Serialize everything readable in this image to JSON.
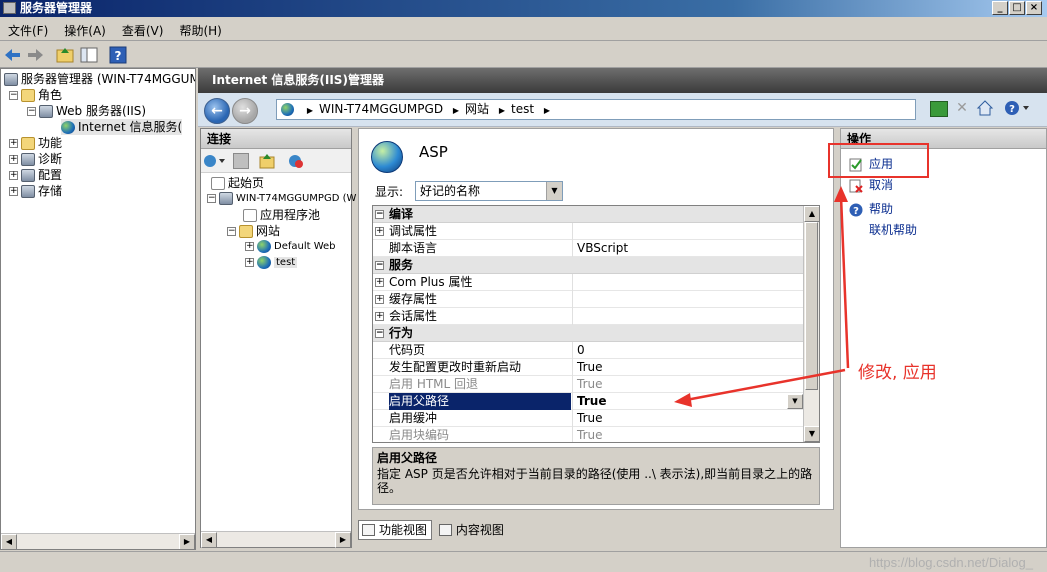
{
  "window": {
    "title": "服务器管理器"
  },
  "menu": [
    "文件(F)",
    "操作(A)",
    "查看(V)",
    "帮助(H)"
  ],
  "left_tree": {
    "root": "服务器管理器 (WIN-T74MGGUMPG",
    "roles": "角色",
    "web_server": "Web 服务器(IIS)",
    "iis_manager": "Internet 信息服务(",
    "features": "功能",
    "diagnostics": "诊断",
    "config": "配置",
    "storage": "存储"
  },
  "iis": {
    "header": "Internet 信息服务(IIS)管理器"
  },
  "address": {
    "parts": [
      "WIN-T74MGGUMPGD",
      "网站",
      "test"
    ]
  },
  "connections": {
    "title": "连接",
    "tree": {
      "start": "起始页",
      "server": "WIN-T74MGGUMPGD (W",
      "apppools": "应用程序池",
      "sites": "网站",
      "default_web": "Default Web",
      "test": "test"
    }
  },
  "feature": {
    "title": "ASP",
    "show_label": "显示:",
    "show_value": "好记的名称",
    "grid": {
      "c1": "编译",
      "r1": "调试属性",
      "r2n": "脚本语言",
      "r2v": "VBScript",
      "c2": "服务",
      "r3": "Com Plus 属性",
      "r4": "缓存属性",
      "r5": "会话属性",
      "c3": "行为",
      "r6n": "代码页",
      "r6v": "0",
      "r7n": "发生配置更改时重新启动",
      "r7v": "True",
      "r8n": "启用 HTML 回退",
      "r8v": "True",
      "r9n": "启用父路径",
      "r9v": "True",
      "r10n": "启用缓冲",
      "r10v": "True",
      "r11n": "启用块编码",
      "r11v": "True"
    },
    "desc_title": "启用父路径",
    "desc_text": "指定 ASP 页是否允许相对于当前目录的路径(使用 ..\\ 表示法),即当前目录之上的路径。"
  },
  "views": {
    "feature_view": "功能视图",
    "content_view": "内容视图"
  },
  "actions": {
    "title": "操作",
    "apply": "应用",
    "cancel": "取消",
    "help": "帮助",
    "online_help": "联机帮助"
  },
  "annotation": "修改, 应用",
  "watermark": "https://blog.csdn.net/Dialog_"
}
